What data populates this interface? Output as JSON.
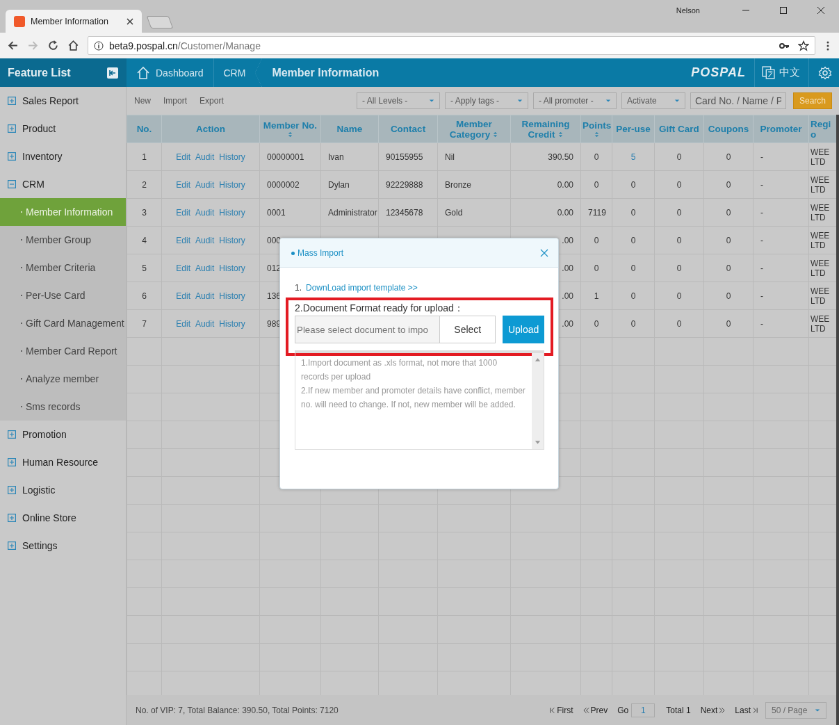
{
  "browser": {
    "tab_title": "Member Information",
    "user": "Nelson",
    "url_host": "beta9.pospal.cn",
    "url_path": "/Customer/Manage"
  },
  "sidebar": {
    "title": "Feature List",
    "items": [
      {
        "label": "Sales Report",
        "expanded": false
      },
      {
        "label": "Product",
        "expanded": false
      },
      {
        "label": "Inventory",
        "expanded": false
      },
      {
        "label": "CRM",
        "expanded": true,
        "children": [
          {
            "label": "Member Information",
            "selected": true
          },
          {
            "label": "Member Group",
            "selected": false
          },
          {
            "label": "Member Criteria",
            "selected": false
          },
          {
            "label": "Per-Use Card",
            "selected": false
          },
          {
            "label": "Gift Card Management",
            "selected": false
          },
          {
            "label": "Member Card Report",
            "selected": false
          },
          {
            "label": "Analyze member",
            "selected": false
          },
          {
            "label": "Sms records",
            "selected": false
          }
        ]
      },
      {
        "label": "Promotion",
        "expanded": false
      },
      {
        "label": "Human Resource",
        "expanded": false
      },
      {
        "label": "Logistic",
        "expanded": false
      },
      {
        "label": "Online Store",
        "expanded": false
      },
      {
        "label": "Settings",
        "expanded": false
      }
    ]
  },
  "header": {
    "breadcrumb": [
      "Dashboard",
      "CRM",
      "Member Information"
    ],
    "logo": "POSPAL",
    "language": "中文"
  },
  "toolbar": {
    "actions": [
      "New",
      "Import",
      "Export"
    ],
    "filters": [
      "- All Levels -",
      "- Apply tags -",
      "- All promoter -",
      "Activate"
    ],
    "search": {
      "placeholder": "Card No. / Name / P"
    },
    "search_button": "Search"
  },
  "table": {
    "columns": [
      {
        "label": "No.",
        "sortable": false
      },
      {
        "label": "Action",
        "sortable": false
      },
      {
        "label": "Member No.",
        "sortable": true
      },
      {
        "label": "Name",
        "sortable": false
      },
      {
        "label": "Contact",
        "sortable": false
      },
      {
        "label": "Member Category",
        "sortable": true
      },
      {
        "label": "Remaining Credit",
        "sortable": true
      },
      {
        "label": "Points",
        "sortable": true
      },
      {
        "label": "Per-use",
        "sortable": false
      },
      {
        "label": "Gift Card",
        "sortable": false
      },
      {
        "label": "Coupons",
        "sortable": false
      },
      {
        "label": "Promoter",
        "sortable": false
      },
      {
        "label": "Regi o",
        "sortable": false
      }
    ],
    "rows": [
      {
        "no": "1",
        "actions": [
          "Edit",
          "Audit",
          "History"
        ],
        "member_no": "00000001",
        "name": "Ivan",
        "contact": "90155955",
        "category": "Nil",
        "credit": "390.50",
        "points": "0",
        "per_use": {
          "text": "5",
          "link": true
        },
        "gift_card": "0",
        "coupons": "0",
        "promoter": "-",
        "column_13": "WEE LTD"
      },
      {
        "no": "2",
        "actions": [
          "Edit",
          "Audit",
          "History"
        ],
        "member_no": "0000002",
        "name": "Dylan",
        "contact": "92229888",
        "category": "Bronze",
        "credit": "0.00",
        "points": "0",
        "per_use": {
          "text": "0",
          "link": false
        },
        "gift_card": "0",
        "coupons": "0",
        "promoter": "-",
        "column_13": "WEE LTD"
      },
      {
        "no": "3",
        "actions": [
          "Edit",
          "Audit",
          "History"
        ],
        "member_no": "0001",
        "name": "Administrator",
        "contact": "12345678",
        "category": "Gold",
        "credit": "0.00",
        "points": "7119",
        "per_use": {
          "text": "0",
          "link": false
        },
        "gift_card": "0",
        "coupons": "0",
        "promoter": "-",
        "column_13": "WEE LTD"
      },
      {
        "no": "4",
        "actions": [
          "Edit",
          "Audit",
          "History"
        ],
        "member_no": "000",
        "credit": ".00",
        "points": "0",
        "per_use": {
          "text": "0",
          "link": false
        },
        "gift_card": "0",
        "coupons": "0",
        "promoter": "-",
        "column_13": "WEE LTD"
      },
      {
        "no": "5",
        "actions": [
          "Edit",
          "Audit",
          "History"
        ],
        "member_no": "012",
        "credit": ".00",
        "points": "0",
        "per_use": {
          "text": "0",
          "link": false
        },
        "gift_card": "0",
        "coupons": "0",
        "promoter": "-",
        "column_13": "WEE LTD"
      },
      {
        "no": "6",
        "actions": [
          "Edit",
          "Audit",
          "History"
        ],
        "member_no": "136",
        "credit": ".00",
        "points": "1",
        "per_use": {
          "text": "0",
          "link": false
        },
        "gift_card": "0",
        "coupons": "0",
        "promoter": "-",
        "column_13": "WEE LTD"
      },
      {
        "no": "7",
        "actions": [
          "Edit",
          "Audit",
          "History"
        ],
        "member_no": "989",
        "credit": ".00",
        "points": "0",
        "per_use": {
          "text": "0",
          "link": false
        },
        "gift_card": "0",
        "coupons": "0",
        "promoter": "-",
        "column_13": "WEE LTD"
      }
    ]
  },
  "footer": {
    "summary": "No. of VIP: 7, Total Balance: 390.50, Total Points: 7120",
    "first": "First",
    "prev": "Prev",
    "go": "Go",
    "page": "1",
    "total": "Total 1",
    "next": "Next",
    "last": "Last",
    "page_size": "50 / Page"
  },
  "modal": {
    "title": "Mass Import",
    "step_1_number": "1.",
    "step_1_link": "DownLoad import template >>",
    "step_2": "2.Document Format ready for upload：",
    "file_placeholder": "Please select document to impo",
    "select_button": "Select",
    "upload_button": "Upload",
    "notes": [
      "1.Import document as .xls format, not more that 1000 records per upload",
      "2.If new member and promoter details have conflict, member no. will need to change. If not, new member will be added."
    ]
  }
}
